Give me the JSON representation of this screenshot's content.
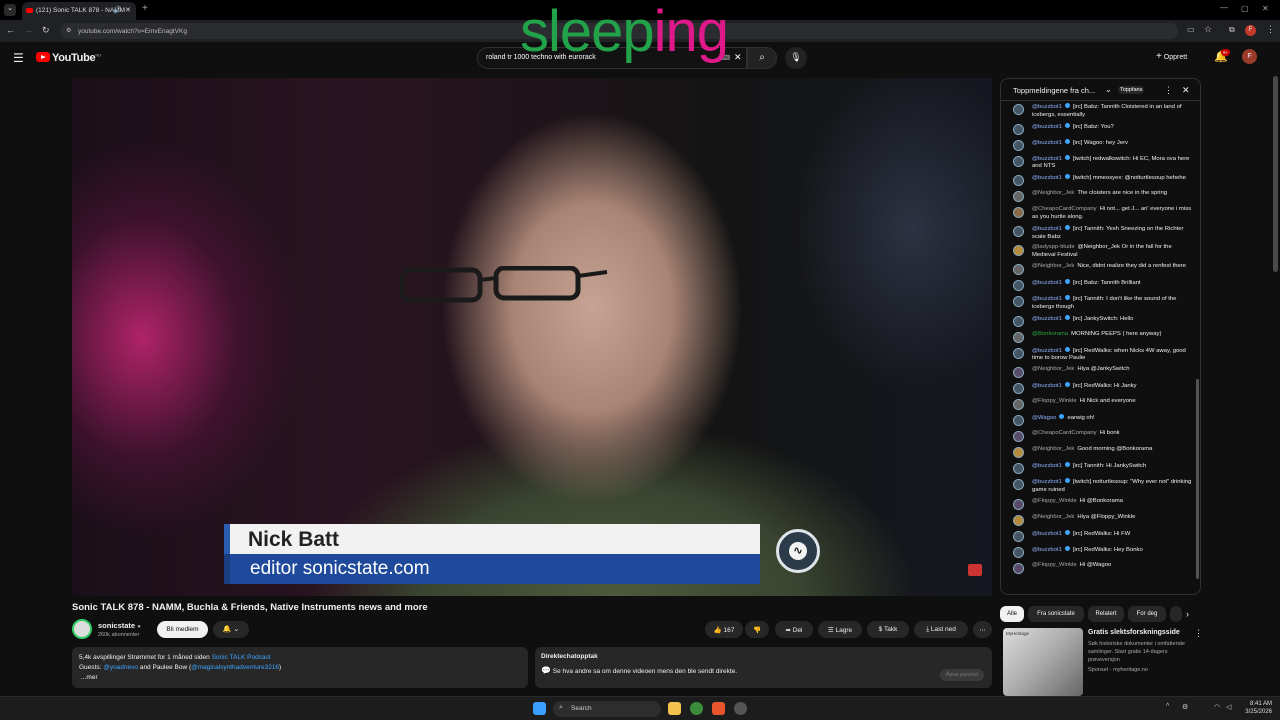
{
  "browser": {
    "tab_title": "(121) Sonic TALK 878 - NAMM",
    "url": "youtube.com/watch?v=EmvEnagtVKg"
  },
  "overlay": {
    "text": "sleeping"
  },
  "header": {
    "logo": "YouTube",
    "logo_region": "NO",
    "search_value": "roland tr 1000 techno with eurorack",
    "create_label": "Opprett",
    "notif_count": "9+",
    "avatar_letter": "F"
  },
  "video": {
    "lower_third_name": "Nick Batt",
    "lower_third_sub": "editor sonicstate.com"
  },
  "meta": {
    "title": "Sonic TALK 878 - NAMM, Buchla & Friends, Native Instruments news and more",
    "channel": "sonicstate",
    "subs": "260k abonnenter",
    "member_label": "Bli medlem",
    "likes": "167",
    "share": "Del",
    "save": "Lagre",
    "thanks": "Takk",
    "download": "Last ned"
  },
  "description": {
    "stats": "5,4k avspillinger  Strømmet for 1 måned siden",
    "podcast": "Sonic TALK Podcast",
    "guests_prefix": "Guests:",
    "guest1": "@yoadnevo",
    "guests_mid": "and Paulee Bow (",
    "guest2": "@magicalsynthadventure3216",
    "guests_end": ")",
    "more": "...mer"
  },
  "chat_replay": {
    "title": "Direktechatopptak",
    "text": "Se hva andre sa om denne videoen mens den ble sendt direkte.",
    "button": "Åpne panelet"
  },
  "chat": {
    "header": "Toppmeldingene fra ch...",
    "top_fans": "Toppfans",
    "messages": [
      {
        "author": "@buzzbot1",
        "text": "[irc] Babz: Tannith Cloistered in an land of icebergs, essentially",
        "style": "bot"
      },
      {
        "author": "@buzzbot1",
        "text": "[irc] Babz: You?",
        "style": "bot"
      },
      {
        "author": "@buzzbot1",
        "text": "[irc] Wagoo: hey Jerv",
        "style": "bot"
      },
      {
        "author": "@buzzbot1",
        "text": "[twitch] redwalkswitch: Hi EC, Mora ova here and NTS",
        "style": "bot"
      },
      {
        "author": "@buzzbot1",
        "text": "[twitch] mmeosyex: @notturtlesoup hehehe",
        "style": "bot"
      },
      {
        "author": "@Neighbor_Jek",
        "text": "The cloisters are nice in the spring",
        "style": "plain"
      },
      {
        "author": "@CheapoCardCompany",
        "text": "Hi not... get J... an' everyone i miss as you hurtle along.",
        "style": "plain"
      },
      {
        "author": "@buzzbot1",
        "text": "[irc] Tannith: Yesh Sneezing on the Richter scale Babz",
        "style": "bot"
      },
      {
        "author": "@ladyspp-titude",
        "text": "@Neighbor_Jek Or in the fall for the Medieval Festival",
        "style": "plain"
      },
      {
        "author": "@Neighbor_Jek",
        "text": "Nice, didnt realize they did a renfest there",
        "style": "plain"
      },
      {
        "author": "@buzzbot1",
        "text": "[irc] Babz: Tannith Brilliant",
        "style": "bot"
      },
      {
        "author": "@buzzbot1",
        "text": "[irc] Tannith: I don't like the sound of the icebergs though",
        "style": "bot"
      },
      {
        "author": "@buzzbot1",
        "text": "[irc] JankySwitch: Hello",
        "style": "bot"
      },
      {
        "author": "@Bonkorama",
        "text": "MORNING PEEPS ( here anyway)",
        "style": "green"
      },
      {
        "author": "@buzzbot1",
        "text": "[irc] RedWalks: when Nicks 4W away, good time to borow Paulie",
        "style": "bot"
      },
      {
        "author": "@Neighbor_Jek",
        "text": "Hiya @JankySwitch",
        "style": "plain"
      },
      {
        "author": "@buzzbot1",
        "text": "[irc] RedWalks: Hi Janky",
        "style": "bot"
      },
      {
        "author": "@Floppy_Winkle",
        "text": "Hi Nick and everyone",
        "style": "plain"
      },
      {
        "author": "@Wagoo",
        "text": "earwig oh!",
        "style": "bot"
      },
      {
        "author": "@CheapoCardCompany",
        "text": "Hi bonk",
        "style": "plain"
      },
      {
        "author": "@Neighbor_Jek",
        "text": "Good morning @Bonkorama",
        "style": "plain"
      },
      {
        "author": "@buzzbot1",
        "text": "[irc] Tannith: Hi JankySwitch",
        "style": "bot"
      },
      {
        "author": "@buzzbot1",
        "text": "[twitch] notturtlesoup: \"Why ever not\" drinking game ruined",
        "style": "bot"
      },
      {
        "author": "@Floppy_Winkle",
        "text": "Hi @Bonkorama",
        "style": "plain"
      },
      {
        "author": "@Neighbor_Jek",
        "text": "Hiya @Floppy_Winkle",
        "style": "plain"
      },
      {
        "author": "@buzzbot1",
        "text": "[irc] RedWalks: Hi FW",
        "style": "bot"
      },
      {
        "author": "@buzzbot1",
        "text": "[irc] RedWalks: Hey Bonko",
        "style": "bot"
      },
      {
        "author": "@Floppy_Winkle",
        "text": "Hi @Wagoo",
        "style": "plain"
      }
    ]
  },
  "sidebar": {
    "chips": [
      "Alle",
      "Fra sonicstate",
      "Relatert",
      "For deg"
    ],
    "ad_title": "Gratis slektsforskningsside",
    "ad_text": "Søk historiske dokumenter i omfattende samlinger. Start gratis 14-dagers prøveversjon",
    "ad_sponsor": "Sponset · myheritage.no",
    "ad_brand": "MyHeritage"
  },
  "taskbar": {
    "search": "Search",
    "time": "8:41 AM",
    "date": "3/25/2026"
  },
  "colors": {
    "accent_red": "#ff0000",
    "link_blue": "#3ea6ff",
    "overlay_green": "#22a34a",
    "overlay_magenta": "#e0198a"
  }
}
